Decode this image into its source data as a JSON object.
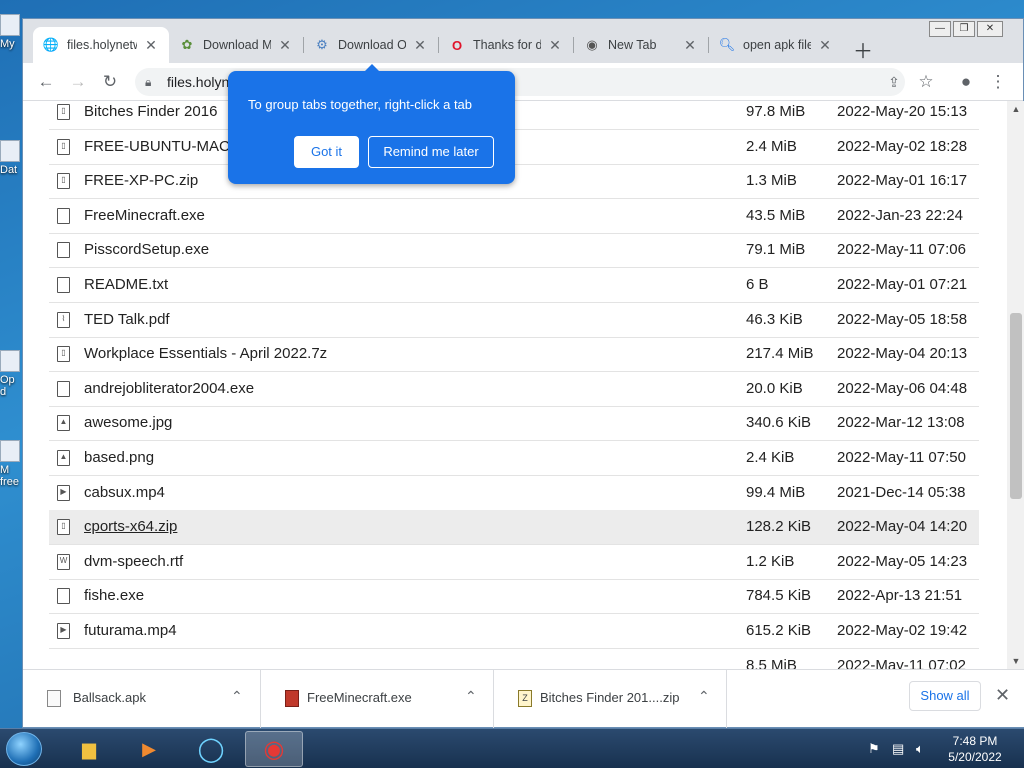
{
  "tabs": [
    {
      "title": "files.holynetw",
      "icon": "globe-icon",
      "active": true
    },
    {
      "title": "Download M",
      "icon": "download-site-icon"
    },
    {
      "title": "Download Op",
      "icon": "opera-site-icon"
    },
    {
      "title": "Thanks for d",
      "icon": "opera-icon"
    },
    {
      "title": "New Tab",
      "icon": "chrome-icon"
    },
    {
      "title": "open apk file",
      "icon": "search-icon"
    }
  ],
  "address": {
    "url": "files.holyn"
  },
  "popup": {
    "text": "To group tabs together, right-click a tab",
    "got_it": "Got it",
    "remind": "Remind me later"
  },
  "files": [
    {
      "name": "Bitches Finder 2016",
      "size": "97.8 MiB",
      "date": "2022-May-20 15:13",
      "icon": "archive-file-icon"
    },
    {
      "name": "FREE-UBUNTU-MAC",
      "size": "2.4 MiB",
      "date": "2022-May-02 18:28",
      "icon": "archive-file-icon"
    },
    {
      "name": "FREE-XP-PC.zip",
      "size": "1.3 MiB",
      "date": "2022-May-01 16:17",
      "icon": "archive-file-icon"
    },
    {
      "name": "FreeMinecraft.exe",
      "size": "43.5 MiB",
      "date": "2022-Jan-23 22:24",
      "icon": "file-icon"
    },
    {
      "name": "PisscordSetup.exe",
      "size": "79.1 MiB",
      "date": "2022-May-11 07:06",
      "icon": "file-icon"
    },
    {
      "name": "README.txt",
      "size": "6 B",
      "date": "2022-May-01 07:21",
      "icon": "file-icon"
    },
    {
      "name": "TED Talk.pdf",
      "size": "46.3 KiB",
      "date": "2022-May-05 18:58",
      "icon": "pdf-file-icon"
    },
    {
      "name": "Workplace Essentials - April 2022.7z",
      "size": "217.4 MiB",
      "date": "2022-May-04 20:13",
      "icon": "archive-file-icon"
    },
    {
      "name": "andrejobliterator2004.exe",
      "size": "20.0 KiB",
      "date": "2022-May-06 04:48",
      "icon": "file-icon"
    },
    {
      "name": "awesome.jpg",
      "size": "340.6 KiB",
      "date": "2022-Mar-12 13:08",
      "icon": "image-file-icon"
    },
    {
      "name": "based.png",
      "size": "2.4 KiB",
      "date": "2022-May-11 07:50",
      "icon": "image-file-icon"
    },
    {
      "name": "cabsux.mp4",
      "size": "99.4 MiB",
      "date": "2021-Dec-14 05:38",
      "icon": "video-file-icon"
    },
    {
      "name": "cports-x64.zip",
      "size": "128.2 KiB",
      "date": "2022-May-04 14:20",
      "icon": "archive-file-icon",
      "hover": true
    },
    {
      "name": "dvm-speech.rtf",
      "size": "1.2 KiB",
      "date": "2022-May-05 14:23",
      "icon": "word-file-icon"
    },
    {
      "name": "fishe.exe",
      "size": "784.5 KiB",
      "date": "2022-Apr-13 21:51",
      "icon": "file-icon"
    },
    {
      "name": "futurama.mp4",
      "size": "615.2 KiB",
      "date": "2022-May-02 19:42",
      "icon": "video-file-icon"
    },
    {
      "name": "",
      "size": "8.5 MiB",
      "date": "2022-May-11 07:02",
      "icon": ""
    }
  ],
  "downloads": [
    {
      "name": "Ballsack.apk",
      "icon": "file-icon"
    },
    {
      "name": "FreeMinecraft.exe",
      "icon": "winrar-icon"
    },
    {
      "name": "Bitches Finder 201....zip",
      "icon": "zip-icon"
    }
  ],
  "shelf": {
    "show_all": "Show all"
  },
  "desktop_labels": [
    "My",
    "Dat",
    "Op",
    "d",
    "M",
    "free"
  ],
  "clock": {
    "time": "7:48 PM",
    "date": "5/20/2022"
  },
  "colors": {
    "accent": "#1a73e8",
    "hover_row": "#ececec"
  }
}
